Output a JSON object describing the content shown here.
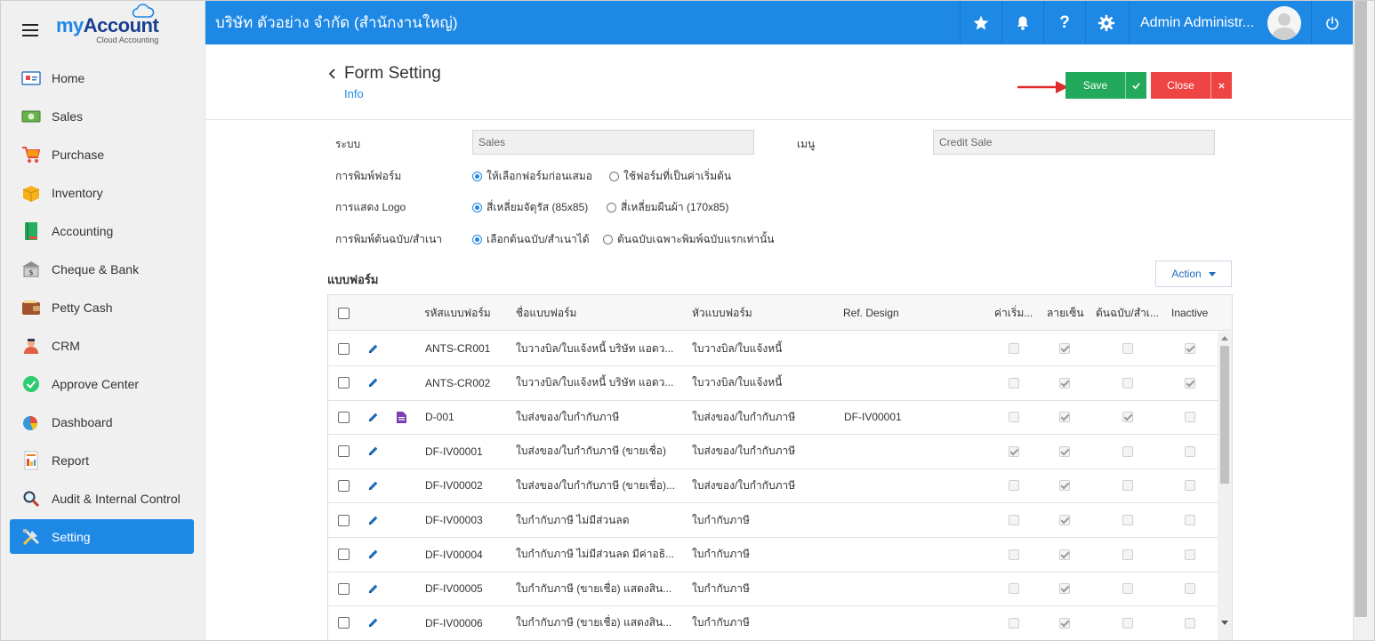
{
  "app": {
    "logo_my": "my",
    "logo_account": "Account",
    "logo_sub": "Cloud Accounting",
    "company": "บริษัท ตัวอย่าง จำกัด (สำนักงานใหญ่)",
    "user": "Admin Administr...",
    "accent": "#1e88e5"
  },
  "sidebar": {
    "items": [
      {
        "label": "Home",
        "icon": "home-icon"
      },
      {
        "label": "Sales",
        "icon": "money-icon"
      },
      {
        "label": "Purchase",
        "icon": "cart-icon"
      },
      {
        "label": "Inventory",
        "icon": "box-icon"
      },
      {
        "label": "Accounting",
        "icon": "book-icon"
      },
      {
        "label": "Cheque & Bank",
        "icon": "bank-icon"
      },
      {
        "label": "Petty Cash",
        "icon": "wallet-icon"
      },
      {
        "label": "CRM",
        "icon": "people-icon"
      },
      {
        "label": "Approve Center",
        "icon": "check-circle-icon"
      },
      {
        "label": "Dashboard",
        "icon": "pie-chart-icon"
      },
      {
        "label": "Report",
        "icon": "report-icon"
      },
      {
        "label": "Audit & Internal Control",
        "icon": "magnifier-icon"
      },
      {
        "label": "Setting",
        "icon": "tools-icon"
      }
    ],
    "active": "Setting"
  },
  "header": {
    "title": "Form Setting",
    "subtitle": "Info",
    "save_label": "Save",
    "close_label": "Close"
  },
  "form": {
    "system_label": "ระบบ",
    "system_value": "Sales",
    "menu_label": "เมนู",
    "menu_value": "Credit Sale",
    "print_label": "การพิมพ์ฟอร์ม",
    "print_opt1": "ให้เลือกฟอร์มก่อนเสมอ",
    "print_opt2": "ใช้ฟอร์มที่เป็นค่าเริ่มต้น",
    "logo_label": "การแสดง Logo",
    "logo_opt1": "สี่เหลี่ยมจัตุรัส (85x85)",
    "logo_opt2": "สี่เหลี่ยมผืนผ้า (170x85)",
    "copy_label": "การพิมพ์ต้นฉบับ/สำเนา",
    "copy_opt1": "เลือกต้นฉบับ/สำเนาได้",
    "copy_opt2": "ต้นฉบับเฉพาะพิมพ์ฉบับแรกเท่านั้น"
  },
  "section": {
    "title": "แบบฟอร์ม",
    "action_label": "Action"
  },
  "table": {
    "headers": {
      "code": "รหัสแบบฟอร์ม",
      "name": "ชื่อแบบฟอร์ม",
      "head": "หัวแบบฟอร์ม",
      "ref": "Ref. Design",
      "default": "ค่าเริ่ม...",
      "watermark": "ลายเซ็น",
      "original": "ต้นฉบับ/สำเ...",
      "inactive": "Inactive"
    },
    "rows": [
      {
        "code": "ANTS-CR001",
        "name": "ใบวางบิล/ใบแจ้งหนี้ บริษัท แอดว...",
        "head": "ใบวางบิล/ใบแจ้งหนี้",
        "ref": "",
        "doc": false,
        "default": false,
        "watermark": true,
        "original": false,
        "inactive": true
      },
      {
        "code": "ANTS-CR002",
        "name": "ใบวางบิล/ใบแจ้งหนี้ บริษัท แอดว...",
        "head": "ใบวางบิล/ใบแจ้งหนี้",
        "ref": "",
        "doc": false,
        "default": false,
        "watermark": true,
        "original": false,
        "inactive": true
      },
      {
        "code": "D-001",
        "name": "ใบส่งของ/ใบกำกับภาษี",
        "head": "ใบส่งของ/ใบกำกับภาษี",
        "ref": "DF-IV00001",
        "doc": true,
        "default": false,
        "watermark": true,
        "original": true,
        "inactive": false
      },
      {
        "code": "DF-IV00001",
        "name": "ใบส่งของ/ใบกำกับภาษี (ขายเชื่อ)",
        "head": "ใบส่งของ/ใบกำกับภาษี",
        "ref": "",
        "doc": false,
        "default": true,
        "watermark": true,
        "original": false,
        "inactive": false
      },
      {
        "code": "DF-IV00002",
        "name": "ใบส่งของ/ใบกำกับภาษี (ขายเชื่อ)...",
        "head": "ใบส่งของ/ใบกำกับภาษี",
        "ref": "",
        "doc": false,
        "default": false,
        "watermark": true,
        "original": false,
        "inactive": false
      },
      {
        "code": "DF-IV00003",
        "name": "ใบกำกับภาษี ไม่มีส่วนลด",
        "head": "ใบกำกับภาษี",
        "ref": "",
        "doc": false,
        "default": false,
        "watermark": true,
        "original": false,
        "inactive": false
      },
      {
        "code": "DF-IV00004",
        "name": "ใบกำกับภาษี ไม่มีส่วนลด มีค่าอธิ...",
        "head": "ใบกำกับภาษี",
        "ref": "",
        "doc": false,
        "default": false,
        "watermark": true,
        "original": false,
        "inactive": false
      },
      {
        "code": "DF-IV00005",
        "name": "ใบกำกับภาษี (ขายเชื่อ) แสดงสิน...",
        "head": "ใบกำกับภาษี",
        "ref": "",
        "doc": false,
        "default": false,
        "watermark": true,
        "original": false,
        "inactive": false
      },
      {
        "code": "DF-IV00006",
        "name": "ใบกำกับภาษี (ขายเชื่อ) แสดงสิน...",
        "head": "ใบกำกับภาษี",
        "ref": "",
        "doc": false,
        "default": false,
        "watermark": true,
        "original": false,
        "inactive": false
      }
    ]
  }
}
